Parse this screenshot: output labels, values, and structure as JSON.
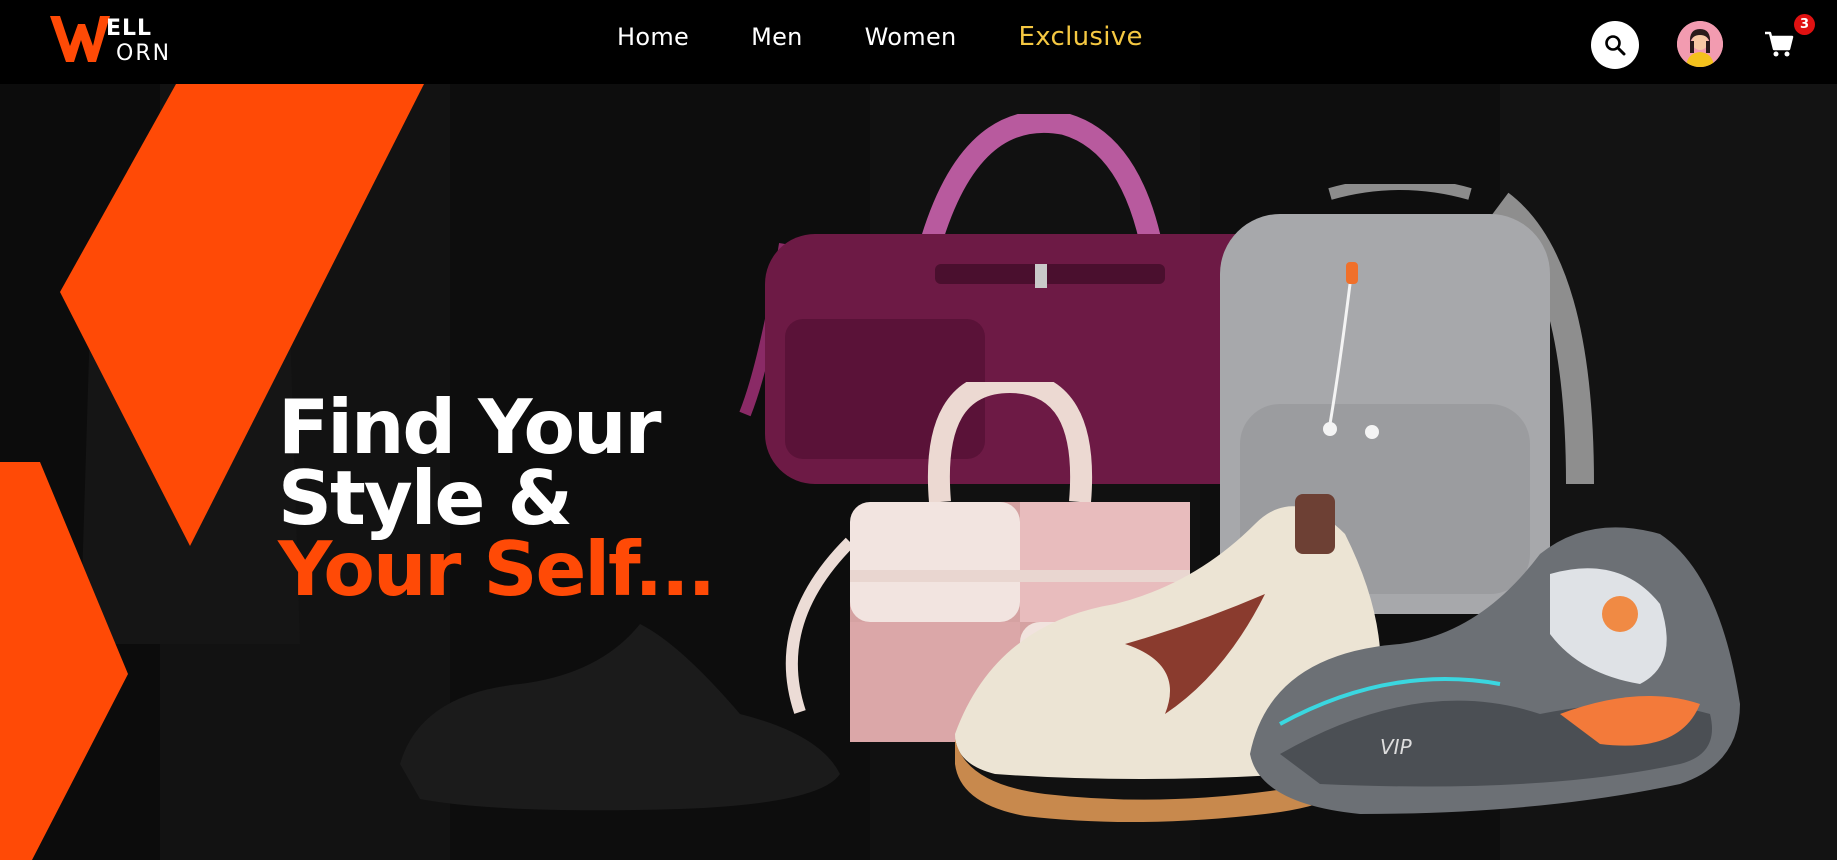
{
  "brand": {
    "name": "WELL ORN",
    "accent_color": "#ff4a06",
    "icon": "wellorn-logo"
  },
  "nav": {
    "links": [
      {
        "label": "Home"
      },
      {
        "label": "Men"
      },
      {
        "label": "Women"
      },
      {
        "label": "Exclusive",
        "color": "#f5c842"
      }
    ]
  },
  "header_actions": {
    "search_icon": "search-icon",
    "avatar_icon": "user-avatar",
    "cart_icon": "shopping-cart-icon",
    "cart_count": "3"
  },
  "hero": {
    "line1": "Find Your",
    "line2": "Style &",
    "line3": "Your Self...",
    "accent_color": "#ff4a06",
    "products": [
      "duffel-bag",
      "handbag",
      "backpack",
      "sneaker",
      "high-top-sneaker"
    ]
  }
}
